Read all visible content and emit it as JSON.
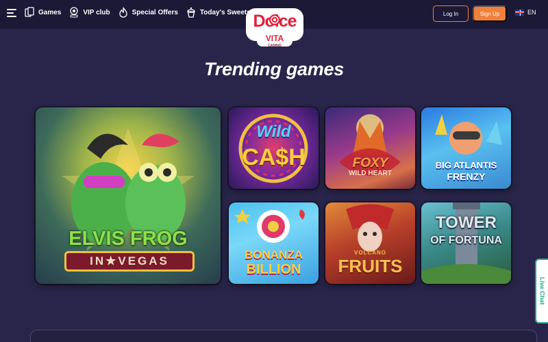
{
  "header": {
    "menu_icon": "hamburger-menu-icon",
    "nav": [
      {
        "label": "Games",
        "icon": "cards-icon"
      },
      {
        "label": "VIP club",
        "icon": "vip-badge-icon"
      },
      {
        "label": "Special Offers",
        "icon": "flame-icon"
      },
      {
        "label": "Today's Sweets",
        "icon": "cupcake-icon"
      }
    ],
    "logo": {
      "line1": "Dolce",
      "line2": "VITA",
      "line3": "CASINO"
    },
    "login_label": "Log In",
    "signup_label": "Sign Up",
    "language": "EN",
    "language_icon": "uk-flag-icon"
  },
  "section": {
    "title": "Trending games"
  },
  "games": [
    {
      "line1": "ELVIS FROG",
      "line2": "IN★VEGAS"
    },
    {
      "line1": "Wild",
      "line2": "CA$H"
    },
    {
      "line1": "FOXY",
      "line2": "WILD HEART"
    },
    {
      "line1": "BIG ATLANTIS",
      "line2": "FRENZY"
    },
    {
      "line1": "BONANZA",
      "line2": "BILLION"
    },
    {
      "line1": "VOLCANO",
      "line2": "FRUITS"
    },
    {
      "line1": "TOWER",
      "line2": "OF FORTUNA"
    }
  ],
  "live_chat": {
    "label": "Live Chat"
  },
  "colors": {
    "background": "#29254a",
    "header_bg": "#1c1936",
    "accent_orange": "#f0803c",
    "live_chat_green": "#27a88a"
  }
}
